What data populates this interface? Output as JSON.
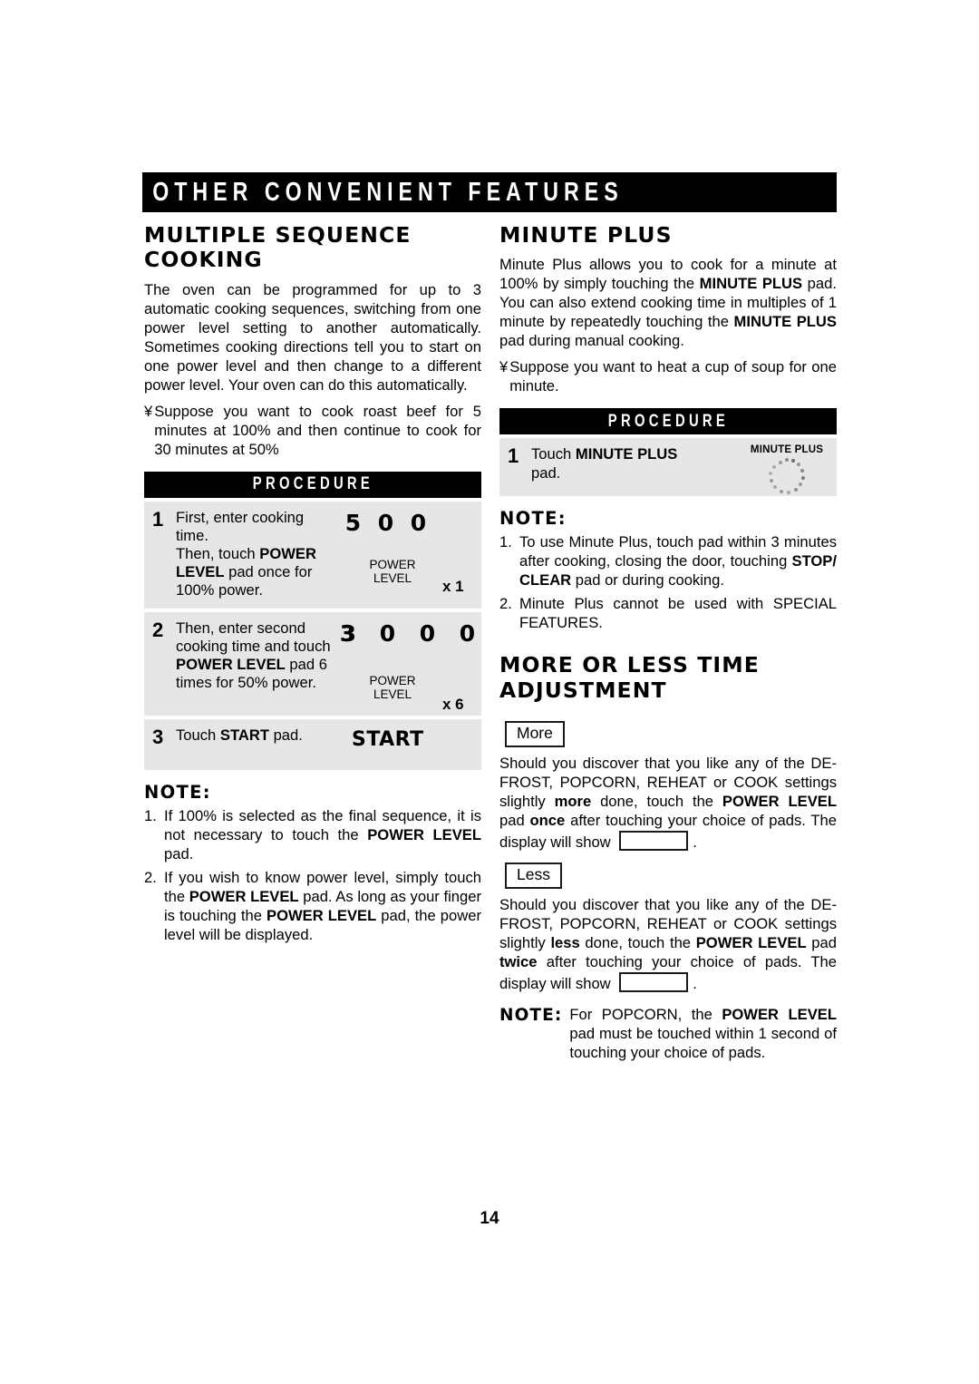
{
  "banner": {
    "title": "OTHER CONVENIENT FEATURES"
  },
  "page_number": "14",
  "left_column": {
    "section_title": "MULTIPLE SEQUENCE COOKING",
    "paragraph_1": "The oven can be programmed for up to 3 automatic cooking sequences, switching from one power level setting to another automatically. Sometimes cooking directions tell you to start on one power level and then change to a different power level. Your oven can do this automatically.",
    "bullet_mark": "¥",
    "bullet_text": "Suppose you want to cook roast beef for 5 minutes at 100% and then continue to cook for 30 minutes at 50%",
    "procedure": {
      "header": "PROCEDURE",
      "steps": [
        {
          "number": "1",
          "text_parts": [
            "First, enter cooking time.",
            "Then, touch ",
            "POWER LEVEL",
            " pad once for 100% power."
          ],
          "display_digits": [
            "5",
            "0",
            "0"
          ],
          "pad_label_line1": "POWER",
          "pad_label_line2": "LEVEL",
          "pad_count": "x 1"
        },
        {
          "number": "2",
          "text_parts": [
            "Then, enter second cooking time and touch ",
            "POWER LEVEL",
            " pad 6 times for 50% power."
          ],
          "display_digits": [
            "3",
            "0",
            "0",
            "0"
          ],
          "pad_label_line1": "POWER",
          "pad_label_line2": "LEVEL",
          "pad_count": "x 6"
        },
        {
          "number": "3",
          "text_prefix": "Touch ",
          "text_bold": "START",
          "text_suffix": " pad.",
          "pad_name": "START"
        }
      ]
    },
    "note_heading": "NOTE:",
    "notes": [
      {
        "num": "1.",
        "parts": [
          "If 100% is selected as the final sequence, it is not necessary to touch the ",
          "POWER LEVEL",
          " pad."
        ]
      },
      {
        "num": "2.",
        "parts": [
          "If you wish to know power level, simply touch the ",
          "POWER LEVEL",
          " pad. As long as your finger is touching the ",
          "POWER LEVEL",
          " pad, the power level will be displayed."
        ]
      }
    ]
  },
  "right_column": {
    "minute_plus": {
      "section_title": "MINUTE PLUS",
      "paragraph_parts": [
        "Minute Plus allows you to cook for a minute at 100% by simply touching the ",
        "MINUTE PLUS",
        " pad. You can also extend cooking time in multiples of 1 minute by repeatedly touching the ",
        "MINUTE PLUS",
        " pad during manual cooking."
      ],
      "bullet_mark": "¥",
      "bullet_text": "Suppose you want to heat a cup of soup for one minute.",
      "procedure": {
        "header": "PROCEDURE",
        "step_number": "1",
        "step_text_prefix": "Touch ",
        "step_text_bold": "MINUTE PLUS",
        "step_text_suffix": " pad.",
        "pad_label": "MINUTE PLUS"
      },
      "note_heading": "NOTE:",
      "notes": [
        {
          "num": "1.",
          "parts": [
            "To use Minute Plus, touch pad within 3 minutes after cooking, closing the door, touching ",
            "STOP/ CLEAR",
            " pad or during cooking."
          ]
        },
        {
          "num": "2.",
          "parts": [
            "Minute Plus cannot be used with SPECIAL FEATURES."
          ]
        }
      ]
    },
    "more_less": {
      "section_title": "MORE OR LESS TIME ADJUSTMENT",
      "more_tag": "More",
      "more_parts": [
        "Should you discover that you like any of the DE-FROST, POPCORN, REHEAT or COOK settings slightly ",
        "more",
        " done, touch the ",
        "POWER LEVEL",
        " pad ",
        "once",
        " after touching your choice of pads. The display will show "
      ],
      "more_trailing": ".",
      "less_tag": "Less",
      "less_parts": [
        "Should you discover that you like any of the DE-FROST, POPCORN, REHEAT or COOK settings slightly ",
        "less",
        " done, touch the ",
        "POWER LEVEL",
        " pad ",
        "twice",
        " after touching your choice of pads. The display will show "
      ],
      "less_trailing": ".",
      "note_label": "NOTE:",
      "note_parts": [
        "For POPCORN, the ",
        "POWER LEVEL",
        " pad must be touched within 1 second of touching your choice of pads."
      ]
    }
  }
}
